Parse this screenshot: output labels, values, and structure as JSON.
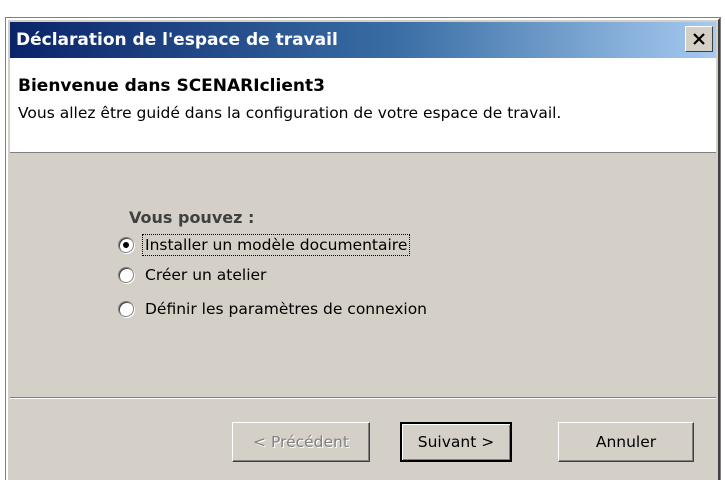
{
  "window": {
    "title": "Déclaration de l'espace de travail",
    "close_symbol": "close-icon"
  },
  "header": {
    "title": "Bienvenue dans SCENARIclient3",
    "description": "Vous allez être guidé dans la configuration de votre espace de travail."
  },
  "options": {
    "label": "Vous pouvez :",
    "items": [
      {
        "label": "Installer un modèle documentaire",
        "checked": true
      },
      {
        "label": "Créer un atelier",
        "checked": false
      },
      {
        "label": "Définir les paramètres de connexion",
        "checked": false
      }
    ]
  },
  "buttons": {
    "previous": "< Précédent",
    "next": "Suivant >",
    "cancel": "Annuler"
  }
}
